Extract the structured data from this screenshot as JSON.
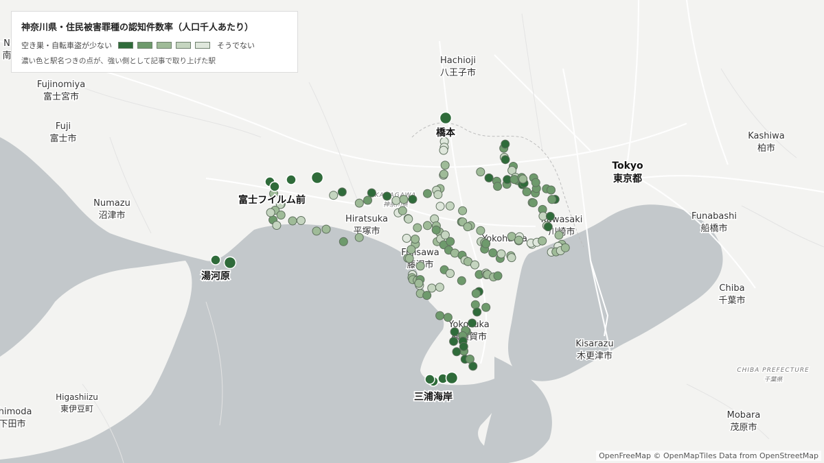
{
  "legend": {
    "title": "神奈川県・住民被害罪種の認知件数率（人口千人あたり）",
    "low_label": "空き巣・自転車盗が少ない",
    "high_label": "そうでない",
    "note": "濃い色と駅名つきの点が、強い側として記事で取り上げた駅",
    "swatches": [
      "#2f6b3a",
      "#6e9a6c",
      "#9fbb98",
      "#c5d5c0",
      "#dfe7dc"
    ]
  },
  "colors": {
    "land": "#f3f3f1",
    "sea": "#c3c8cb",
    "road": "#ffffff",
    "boundary": "#cfcfcf",
    "city_text": "#333333",
    "label_halo": "#ffffff"
  },
  "place_labels": [
    {
      "name": "place-hachioji",
      "lines": [
        "Hachioji",
        "八王子市"
      ]
    },
    {
      "name": "place-fujinomiya",
      "lines": [
        "Fujinomiya",
        "富士宮市"
      ]
    },
    {
      "name": "place-fuji",
      "lines": [
        "Fuji",
        "富士市"
      ]
    },
    {
      "name": "place-numazu",
      "lines": [
        "Numazu",
        "沼津市"
      ]
    },
    {
      "name": "place-hiratsuka",
      "lines": [
        "Hiratsuka",
        "平塚市"
      ]
    },
    {
      "name": "place-fujisawa",
      "lines": [
        "Fujisawa",
        "藤沢市"
      ]
    },
    {
      "name": "place-yokosuka",
      "lines": [
        "Yokosuka",
        "横須賀市"
      ]
    },
    {
      "name": "place-kawasaki",
      "lines": [
        "Kawasaki",
        "川崎市"
      ]
    },
    {
      "name": "place-yokohama",
      "lines": [
        "Yokohama"
      ]
    },
    {
      "name": "place-tokyo",
      "lines": [
        "Tokyo",
        "東京都"
      ]
    },
    {
      "name": "place-kashiwa",
      "lines": [
        "Kashiwa",
        "柏市"
      ]
    },
    {
      "name": "place-funabashi",
      "lines": [
        "Funabashi",
        "船橋市"
      ]
    },
    {
      "name": "place-chiba",
      "lines": [
        "Chiba",
        "千葉市"
      ]
    },
    {
      "name": "place-kisarazu",
      "lines": [
        "Kisarazu",
        "木更津市"
      ]
    },
    {
      "name": "place-mobara",
      "lines": [
        "Mobara",
        "茂原市"
      ]
    },
    {
      "name": "place-higashiizu",
      "lines": [
        "Higashiizu",
        "東伊豆町"
      ]
    },
    {
      "name": "place-shimoda",
      "lines": [
        "Shimoda",
        "下田市"
      ]
    },
    {
      "name": "place-kanagawa",
      "lines": [
        "KANAGAWA",
        "神奈川県"
      ]
    },
    {
      "name": "place-chiba-pref",
      "lines": [
        "CHIBA PREFECTURE",
        "千葉県"
      ]
    },
    {
      "name": "place-n-edge",
      "lines": [
        "N",
        "南"
      ]
    }
  ],
  "stations_highlighted": [
    {
      "name": "橋本",
      "rank": 1
    },
    {
      "name": "富士フイルム前",
      "rank": 1
    },
    {
      "name": "湯河原",
      "rank": 1
    },
    {
      "name": "三浦海岸",
      "rank": 1
    }
  ],
  "attribution": {
    "openfreemap": "OpenFreeMap",
    "copyright": "© OpenMapTiles",
    "data_prefix": "Data from",
    "osm": "OpenStreetMap"
  }
}
